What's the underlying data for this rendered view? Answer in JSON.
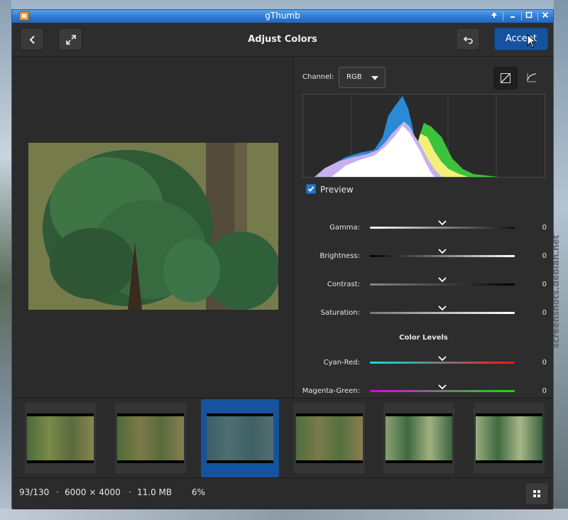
{
  "window": {
    "title": "gThumb"
  },
  "header": {
    "title": "Adjust Colors",
    "accept_label": "Accept"
  },
  "panel": {
    "channel_label": "Channel:",
    "channel_value": "RGB",
    "preview_label": "Preview",
    "preview_checked": true,
    "sliders": [
      {
        "label": "Gamma:",
        "value": "0"
      },
      {
        "label": "Brightness:",
        "value": "0"
      },
      {
        "label": "Contrast:",
        "value": "0"
      },
      {
        "label": "Saturation:",
        "value": "0"
      }
    ],
    "color_levels_title": "Color Levels",
    "levels": [
      {
        "label": "Cyan-Red:",
        "value": "0"
      },
      {
        "label": "Magenta-Green:",
        "value": "0"
      }
    ]
  },
  "status": {
    "position": "93/130",
    "dimensions": "6000 × 4000",
    "size": "11.0 MB",
    "zoom": "6%",
    "separator": "·"
  },
  "watermark": "screenshots.debian.net",
  "colors": {
    "accent": "#15539e",
    "titlebar": "#2e7ad0",
    "background": "#2b2b2b"
  }
}
